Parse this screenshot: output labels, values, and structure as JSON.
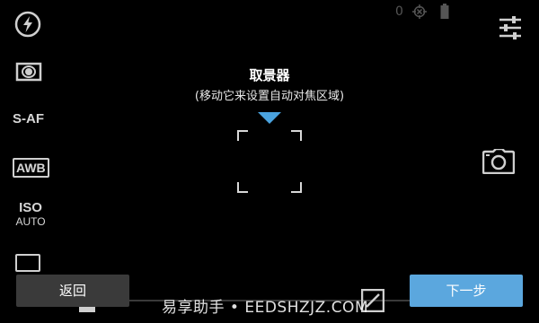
{
  "status": {
    "count": "0"
  },
  "left_controls": {
    "focus_mode": "S-AF",
    "white_balance": "AWB",
    "iso_label": "ISO",
    "iso_value": "AUTO"
  },
  "viewfinder": {
    "title": "取景器",
    "hint": "(移动它来设置自动对焦区域)"
  },
  "buttons": {
    "back": "返回",
    "next": "下一步"
  },
  "watermark": "易享助手 • EEDSHZJZ.COM",
  "colors": {
    "accent": "#4aa3df",
    "button_dark": "#3a3a3a",
    "button_blue": "#5ba7de"
  }
}
